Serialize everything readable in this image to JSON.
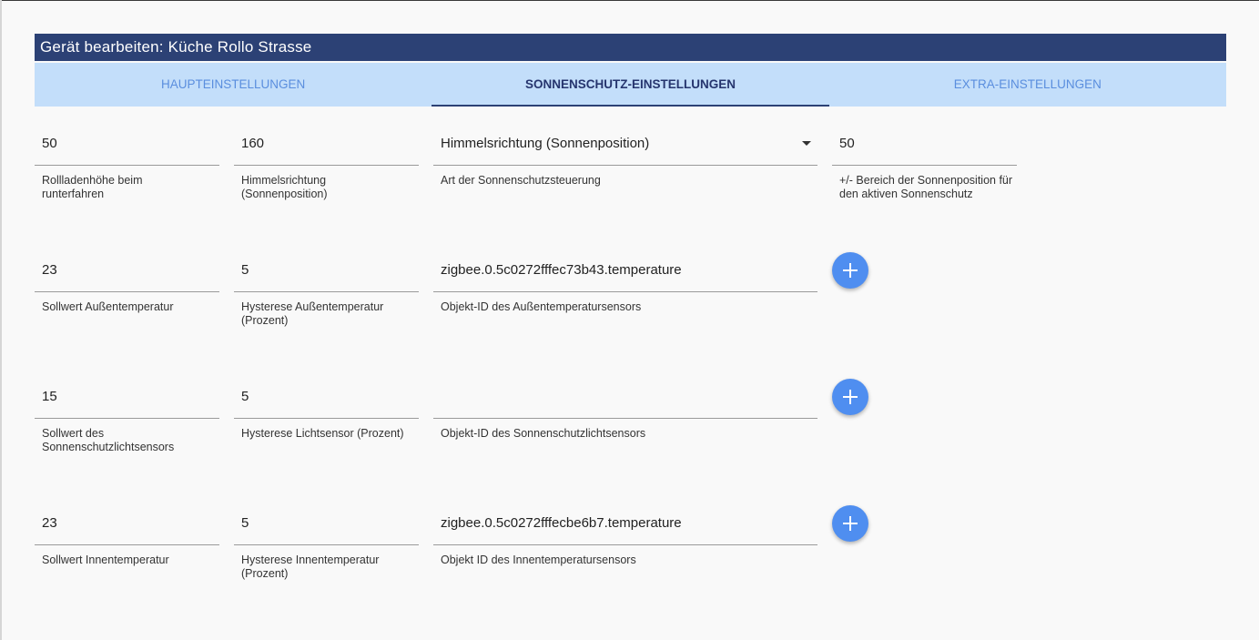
{
  "dialog": {
    "title": "Gerät bearbeiten: Küche Rollo Strasse"
  },
  "tabs": [
    {
      "label": "HAUPTEINSTELLUNGEN",
      "active": false
    },
    {
      "label": "SONNENSCHUTZ-EINSTELLUNGEN",
      "active": true
    },
    {
      "label": "EXTRA-EINSTELLUNGEN",
      "active": false
    }
  ],
  "row1": {
    "height_down": {
      "value": "50",
      "label": "Rollladenhöhe beim runterfahren"
    },
    "direction": {
      "value": "160",
      "label": "Himmelsrichtung (Sonnenposition)"
    },
    "mode": {
      "value": "Himmelsrichtung (Sonnenposition)",
      "label": "Art der Sonnenschutzsteuerung"
    },
    "range": {
      "value": "50",
      "label": "+/- Bereich der Sonnenposition für den aktiven Sonnenschutz"
    }
  },
  "row2": {
    "setpoint": {
      "value": "23",
      "label": "Sollwert Außentemperatur"
    },
    "hysteresis": {
      "value": "5",
      "label": "Hysterese Außentemperatur (Prozent)"
    },
    "object_id": {
      "value": "zigbee.0.5c0272fffec73b43.temperature",
      "label": "Objekt-ID des Außentemperatursensors"
    }
  },
  "row3": {
    "setpoint": {
      "value": "15",
      "label": "Sollwert des Sonnenschutzlichtsensors"
    },
    "hysteresis": {
      "value": "5",
      "label": "Hysterese Lichtsensor (Prozent)"
    },
    "object_id": {
      "value": "",
      "label": "Objekt-ID des Sonnenschutzlichtsensors"
    }
  },
  "row4": {
    "setpoint": {
      "value": "23",
      "label": "Sollwert Innentemperatur"
    },
    "hysteresis": {
      "value": "5",
      "label": "Hysterese Innentemperatur (Prozent)"
    },
    "object_id": {
      "value": "zigbee.0.5c0272fffecbe6b7.temperature",
      "label": "Objekt ID des Innentemperatursensors"
    }
  },
  "colors": {
    "title_bar": "#2c4175",
    "tab_bar": "#c3defa",
    "tab_active_text": "#26356e",
    "tab_inactive_text": "#5a8ede",
    "add_button": "#4f8ef0"
  },
  "icons": {
    "add": "plus-icon",
    "dropdown": "triangle-down-icon"
  }
}
